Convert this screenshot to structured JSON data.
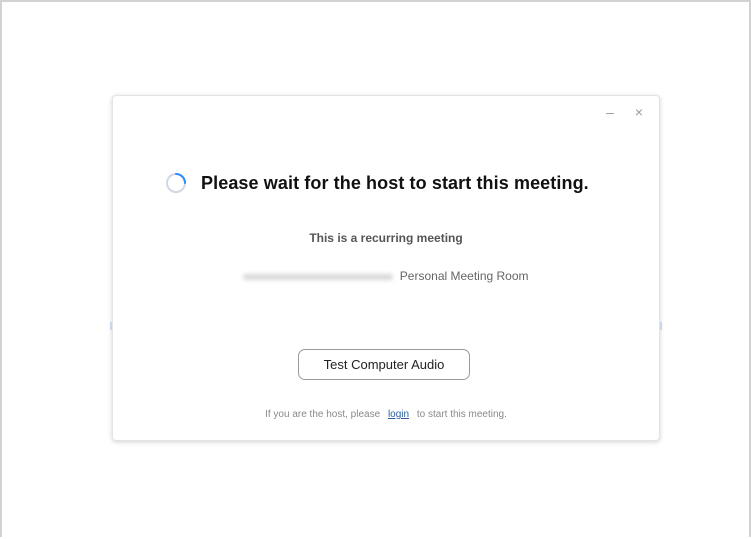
{
  "window": {
    "minimize_glyph": "–",
    "close_glyph": "×",
    "minimize_icon": "minimize-icon",
    "close_icon": "close-icon"
  },
  "main": {
    "status_icon": "loading-spinner-icon",
    "title": "Please wait for the host to start this meeting.",
    "subtitle": "This is a recurring meeting",
    "room_suffix": "Personal Meeting Room",
    "test_audio_label": "Test Computer Audio",
    "footer": {
      "before": "If you are the host, please",
      "link": "login",
      "after": "to start this meeting."
    }
  },
  "colors": {
    "spinner_track": "#cfd8e3",
    "spinner_accent": "#2d8cff",
    "link": "#2b5f9e"
  }
}
